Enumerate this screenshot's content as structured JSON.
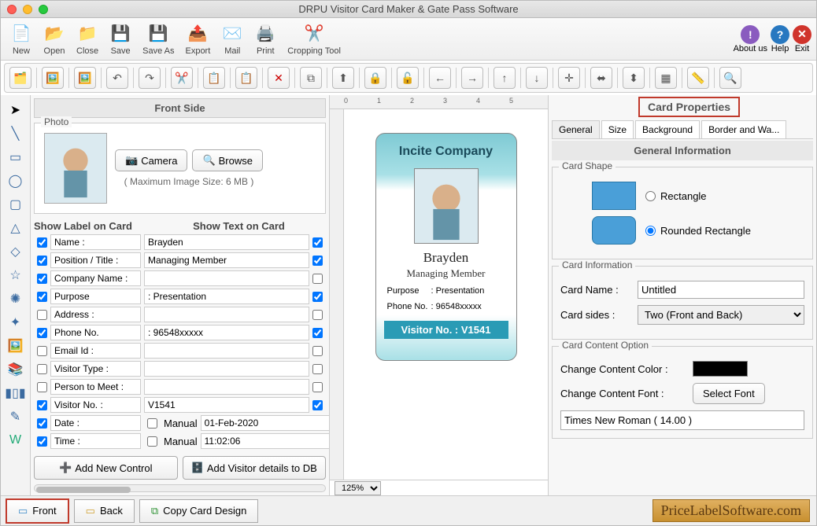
{
  "title": "DRPU Visitor Card Maker & Gate Pass Software",
  "main_toolbar": [
    {
      "label": "New",
      "icon": "new"
    },
    {
      "label": "Open",
      "icon": "open"
    },
    {
      "label": "Close",
      "icon": "close"
    },
    {
      "label": "Save",
      "icon": "save"
    },
    {
      "label": "Save As",
      "icon": "saveas"
    },
    {
      "label": "Export",
      "icon": "export"
    },
    {
      "label": "Mail",
      "icon": "mail"
    },
    {
      "label": "Print",
      "icon": "print"
    },
    {
      "label": "Cropping Tool",
      "icon": "crop"
    }
  ],
  "toolbar_right": {
    "about": "About us",
    "help": "Help",
    "exit": "Exit"
  },
  "front_side": {
    "header": "Front Side",
    "photo_label": "Photo",
    "camera_btn": "Camera",
    "browse_btn": "Browse",
    "max_size": "( Maximum Image Size: 6 MB )",
    "show_label": "Show Label on Card",
    "show_text": "Show Text on Card",
    "fields": [
      {
        "label": "Name :",
        "text": "Brayden",
        "chk_label": true,
        "chk_text": true
      },
      {
        "label": "Position / Title :",
        "text": "Managing Member",
        "chk_label": true,
        "chk_text": true
      },
      {
        "label": "Company Name :",
        "text": "",
        "chk_label": true,
        "chk_text": false
      },
      {
        "label": "Purpose",
        "text": ": Presentation",
        "chk_label": true,
        "chk_text": true
      },
      {
        "label": "Address :",
        "text": "",
        "chk_label": false,
        "chk_text": false
      },
      {
        "label": "Phone No.",
        "text": ": 96548xxxxx",
        "chk_label": true,
        "chk_text": true
      },
      {
        "label": "Email Id :",
        "text": "",
        "chk_label": false,
        "chk_text": false
      },
      {
        "label": "Visitor Type :",
        "text": "",
        "chk_label": false,
        "chk_text": false
      },
      {
        "label": "Person to Meet :",
        "text": "",
        "chk_label": false,
        "chk_text": false
      },
      {
        "label": "Visitor No. :",
        "text": "V1541",
        "chk_label": true,
        "chk_text": true
      },
      {
        "label": "Date :",
        "text": "01-Feb-2020",
        "chk_label": true,
        "chk_text": false,
        "manual": true
      },
      {
        "label": "Time :",
        "text": "11:02:06",
        "chk_label": true,
        "chk_text": false,
        "manual": true
      }
    ],
    "manual_label": "Manual",
    "add_control": "Add New Control",
    "add_db": "Add Visitor details to DB"
  },
  "card": {
    "company": "Incite Company",
    "name": "Brayden",
    "position": "Managing Member",
    "purpose_l": "Purpose",
    "purpose_v": ": Presentation",
    "phone_l": "Phone No.",
    "phone_v": ": 96548xxxxx",
    "visitor": "Visitor No. : V1541"
  },
  "zoom": "125%",
  "props": {
    "title": "Card Properties",
    "tabs": {
      "general": "General",
      "size": "Size",
      "background": "Background",
      "border": "Border and Wa..."
    },
    "section": "General Information",
    "shape": {
      "label": "Card Shape",
      "rect": "Rectangle",
      "rrect": "Rounded Rectangle"
    },
    "info": {
      "label": "Card Information",
      "name_l": "Card Name :",
      "name_v": "Untitled",
      "sides_l": "Card sides :",
      "sides_v": "Two (Front and Back)"
    },
    "content": {
      "label": "Card Content Option",
      "color_l": "Change Content Color :",
      "font_l": "Change Content Font :",
      "font_btn": "Select Font",
      "font_v": "Times New Roman ( 14.00 )"
    }
  },
  "bottom": {
    "front": "Front",
    "back": "Back",
    "copy": "Copy Card Design"
  },
  "watermark": "PriceLabelSoftware.com",
  "ruler": [
    "0",
    "1",
    "2",
    "3",
    "4",
    "5"
  ]
}
